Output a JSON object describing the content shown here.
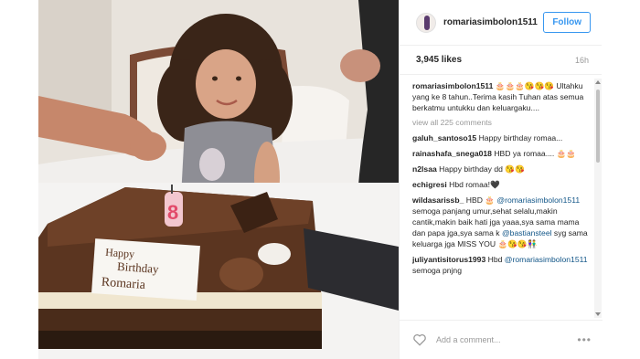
{
  "post": {
    "username": "romariasimbolon1511",
    "follow_label": "Follow",
    "likes": "3,945 likes",
    "time": "16h",
    "photo_text": {
      "cake_line1": "Happy",
      "cake_line2": "Birthday",
      "cake_line3": "Romaria",
      "candle": "8"
    }
  },
  "comments": [
    {
      "user": "romariasimbolon1511",
      "text": " 🎂🎂🎂😘😘😘 Ultahku yang ke 8 tahun..Terima kasih Tuhan atas semua berkatmu untukku dan keluargaku...."
    },
    {
      "user": "galuh_santoso15",
      "text": " Happy birthday romaa..."
    },
    {
      "user": "rainashafa_snega018",
      "text": " HBD ya romaa.... 🎂🎂"
    },
    {
      "user": "n2lsaa",
      "text": " Happy birthday dd 😘😘"
    },
    {
      "user": "echigresi",
      "text": " Hbd romaa!🖤"
    },
    {
      "user": "wildasarissb_",
      "text": " HBD 🎂",
      "mention": "@romariasimbolon1511",
      "text2": " semoga panjang umur,sehat selalu,makin cantik,makin baik hati jga yaaa,sya sama mama dan papa jga,sya sama k ",
      "mention2": "@bastiansteel",
      "text3": " syg sama keluarga jga MISS YOU 🎂😘😘👫"
    },
    {
      "user": "juliyantisitorus1993",
      "text": " Hbd",
      "mention": "@romariasimbolon1511",
      "text2": " semoga pnjng"
    }
  ],
  "view_all": "view all 225 comments",
  "add_comment_placeholder": "Add a comment...",
  "more_label": "•••",
  "colors": {
    "accent": "#3897f0",
    "mention": "#125688",
    "muted": "#999999"
  }
}
